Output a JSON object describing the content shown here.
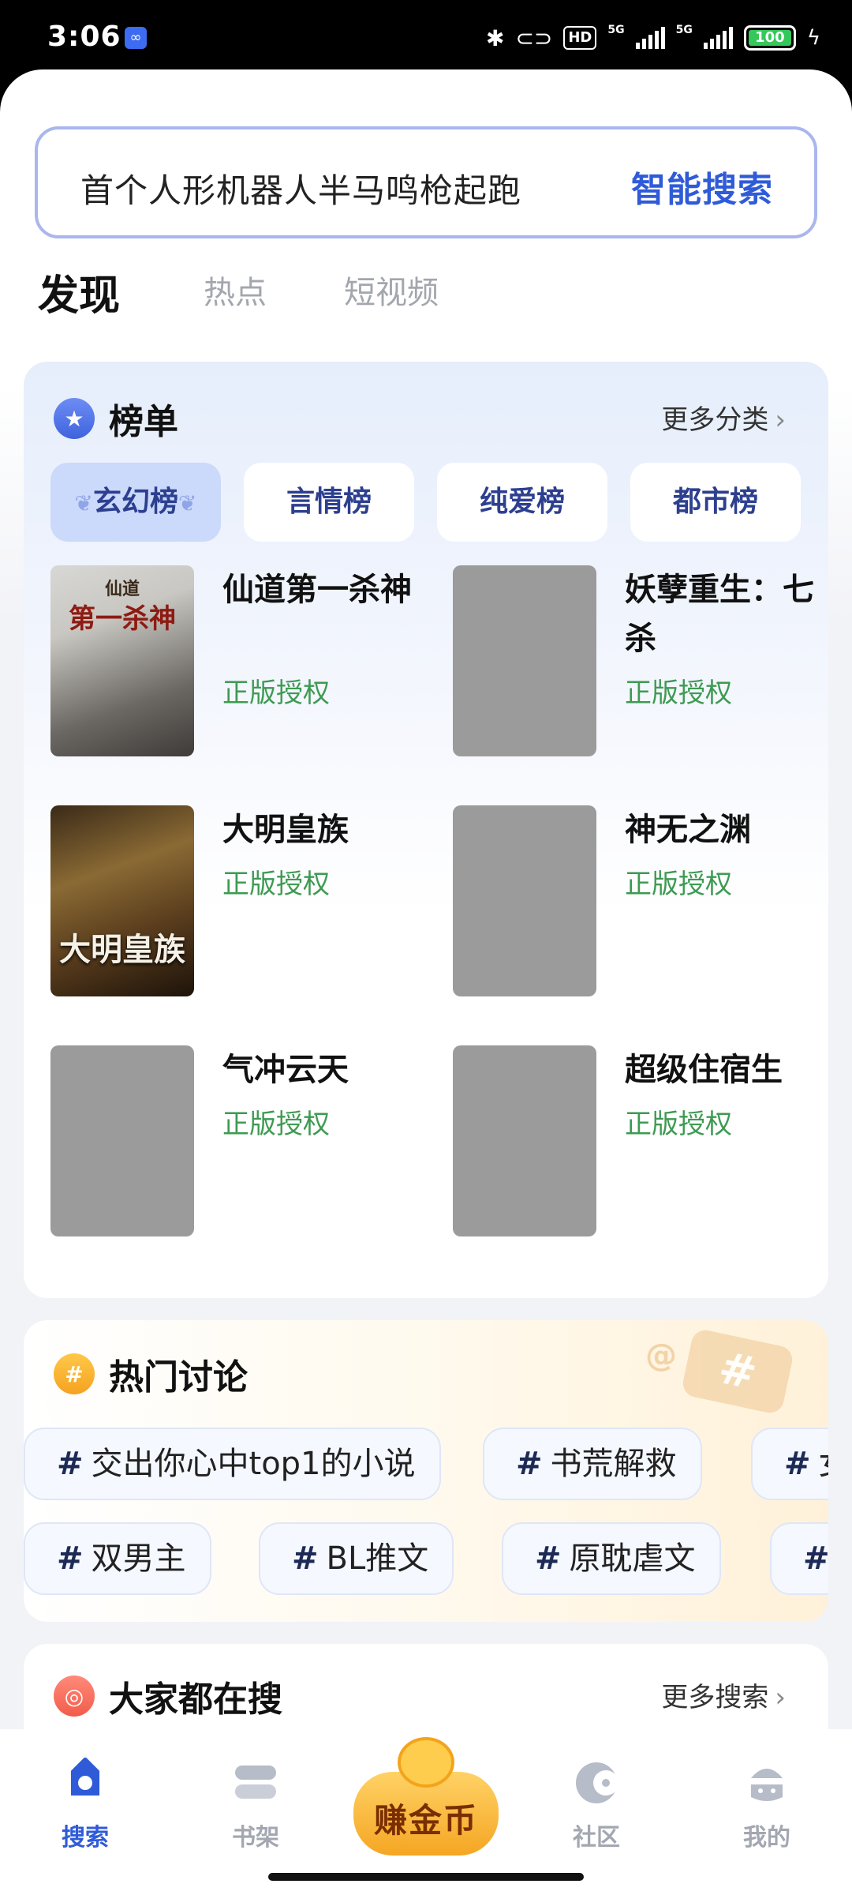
{
  "status_bar": {
    "time": "3:06",
    "icons": [
      "link-icon",
      "bluetooth-icon",
      "nfc-icon",
      "hd-voice-icon",
      "signal-5g-icon",
      "signal-5g-icon",
      "battery-icon",
      "charging-icon"
    ],
    "hd_label": "HD",
    "net_label_1": "5G",
    "net_label_2": "5G",
    "battery": "100"
  },
  "search": {
    "query": "首个人形机器人半马鸣枪起跑",
    "button_label": "智能搜索"
  },
  "tabs": [
    {
      "label": "发现",
      "active": true
    },
    {
      "label": "热点",
      "active": false
    },
    {
      "label": "短视频",
      "active": false
    }
  ],
  "rank": {
    "title": "榜单",
    "more_label": "更多分类",
    "categories": [
      {
        "label": "玄幻榜",
        "active": true
      },
      {
        "label": "言情榜",
        "active": false
      },
      {
        "label": "纯爱榜",
        "active": false
      },
      {
        "label": "都市榜",
        "active": false
      }
    ],
    "books": [
      {
        "title": "仙道第一杀神",
        "tag": "正版授权",
        "cover_text": "第一杀神",
        "cover_small": "仙道"
      },
      {
        "title": "妖孽重生：七杀",
        "tag": "正版授权",
        "cover_text": "",
        "cover_small": ""
      },
      {
        "title": "大明皇族",
        "tag": "正版授权",
        "cover_text": "大明皇族",
        "cover_small": ""
      },
      {
        "title": "神无之渊",
        "tag": "正版授权",
        "cover_text": "",
        "cover_small": ""
      },
      {
        "title": "气冲云天",
        "tag": "正版授权",
        "cover_text": "",
        "cover_small": ""
      },
      {
        "title": "超级住宿生",
        "tag": "正版授权",
        "cover_text": "",
        "cover_small": ""
      }
    ]
  },
  "discussion": {
    "title": "热门讨论",
    "row1": [
      "交出你心中top1的小说",
      "书荒解救",
      "女"
    ],
    "row2": [
      "双男主",
      "BL推文",
      "原耽虐文",
      ""
    ]
  },
  "trending": {
    "title": "大家都在搜",
    "more_label": "更多搜索"
  },
  "nav": {
    "items": [
      {
        "label": "搜索",
        "icon": "search-tag-icon",
        "active": true
      },
      {
        "label": "书架",
        "icon": "bookshelf-icon",
        "active": false
      },
      {
        "label": "赚金币",
        "icon": "gold-coin-icon",
        "active": false
      },
      {
        "label": "社区",
        "icon": "community-icon",
        "active": false
      },
      {
        "label": "我的",
        "icon": "profile-icon",
        "active": false
      }
    ]
  },
  "colors": {
    "accent": "#2f5bd8",
    "tag_green": "#3e9a52",
    "chip_active": "#cbd9fb"
  }
}
